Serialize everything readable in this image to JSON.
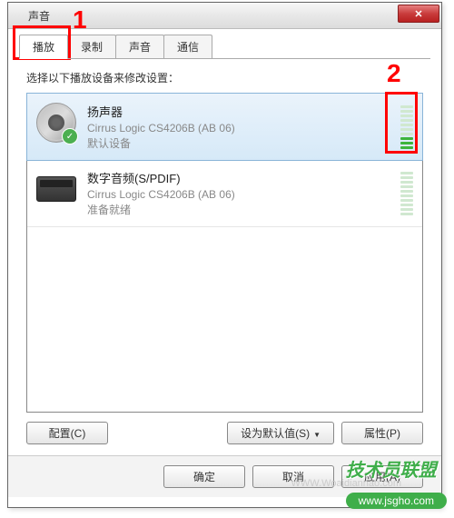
{
  "window": {
    "title": "声音",
    "close_label": "✕"
  },
  "tabs": {
    "playback": "播放",
    "record": "录制",
    "sound": "声音",
    "comm": "通信"
  },
  "instruction": "选择以下播放设备来修改设置：",
  "devices": [
    {
      "name": "扬声器",
      "description": "Cirrus Logic CS4206B (AB 06)",
      "status": "默认设备",
      "default": true,
      "level_bars_total": 10,
      "level_bars_on": 3
    },
    {
      "name": "数字音频(S/PDIF)",
      "description": "Cirrus Logic CS4206B (AB 06)",
      "status": "准备就绪",
      "default": false,
      "level_bars_total": 10,
      "level_bars_on": 0
    }
  ],
  "buttons": {
    "configure": "配置(C)",
    "set_default": "设为默认值(S)",
    "properties": "属性(P)",
    "ok": "确定",
    "cancel": "取消",
    "apply": "应用(A)"
  },
  "annotations": {
    "label1": "1",
    "label2": "2"
  },
  "watermark": {
    "text": "技术员联盟",
    "url": "www.jsgho.com",
    "faded": "WWW.Woaidiannao.com"
  }
}
